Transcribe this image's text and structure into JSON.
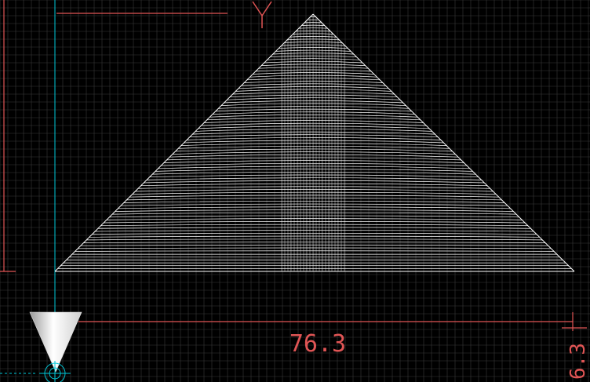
{
  "viewport": {
    "background": "#000000",
    "grid_color": "#3a3a3a",
    "dimension_color": "#e05555",
    "axis_color": "#00c8d8",
    "geometry_color": "#ffffff"
  },
  "axis_labels": {
    "y_label": "Y"
  },
  "dimensions": {
    "width_value": "76.3",
    "height_value": "6.3"
  },
  "toolpath": {
    "shape": "triangle-contour-hatch",
    "layer_count": 90
  },
  "tool": {
    "icon": "cone-tool-icon"
  },
  "origin": {
    "icon": "origin-crosshair-icon"
  }
}
